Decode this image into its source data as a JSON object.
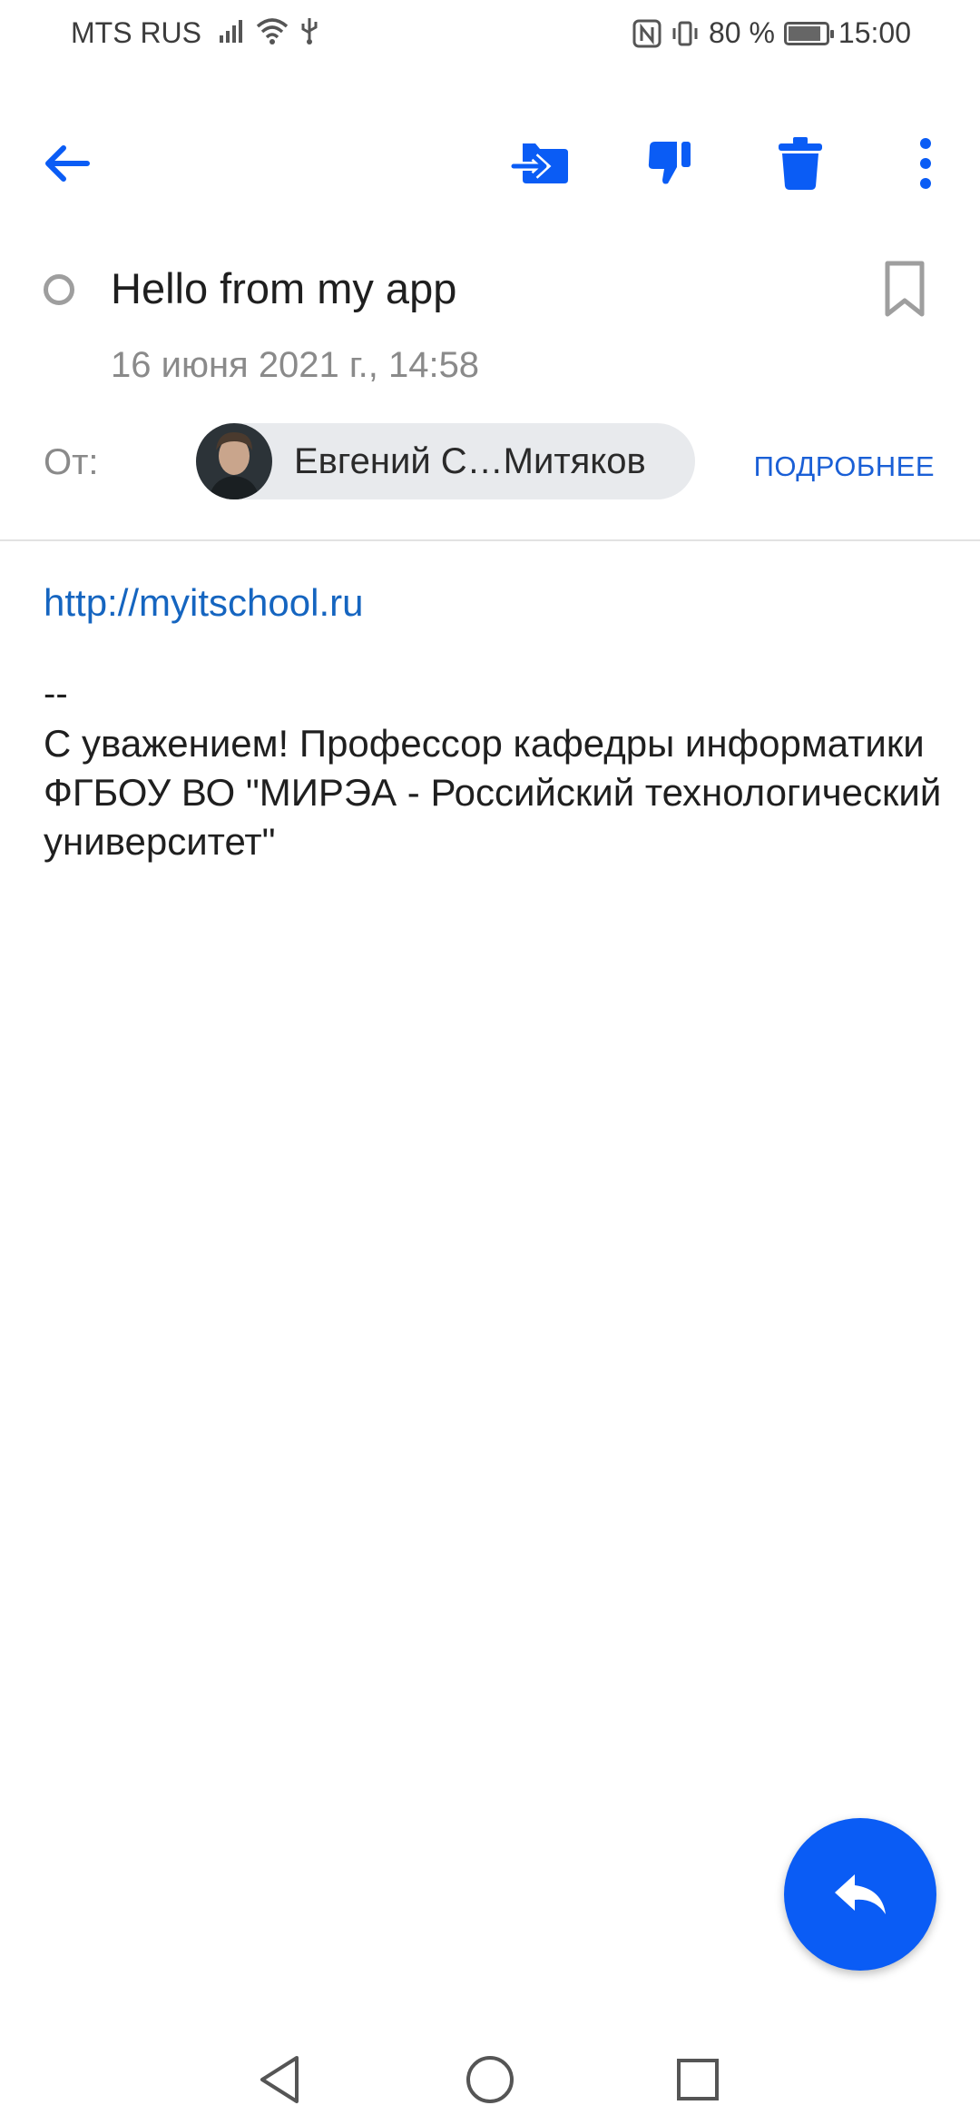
{
  "status_bar": {
    "carrier": "MTS RUS",
    "battery": "80 %",
    "battery_level": 0.8,
    "time": "15:00",
    "icons": [
      "signal-icon",
      "wifi-icon",
      "usb-icon",
      "nfc-icon",
      "vibrate-icon",
      "battery-icon"
    ]
  },
  "toolbar": {
    "icons": [
      "back-arrow-icon",
      "move-to-folder-icon",
      "thumbs-down-icon",
      "trash-icon",
      "more-vert-icon"
    ]
  },
  "message": {
    "subject": "Hello from my app",
    "date": "16 июня 2021 г., 14:58",
    "from_label": "От:",
    "sender": "Евгений С…Митяков",
    "details": "ПОДРОБНЕЕ",
    "link": "http://myitschool.ru",
    "signature_separator": "--",
    "signature": "С уважением! Профессор кафедры информатики ФГБОУ ВО \"МИРЭА - Российский технологический университет\""
  },
  "colors": {
    "accent": "#0a5cf5",
    "link": "#1565c0",
    "muted_text": "#8a8a8a"
  },
  "fab": {
    "icon": "reply-icon"
  },
  "nav_bar": {
    "icons": [
      "back-triangle-icon",
      "home-circle-icon",
      "recents-square-icon"
    ]
  }
}
